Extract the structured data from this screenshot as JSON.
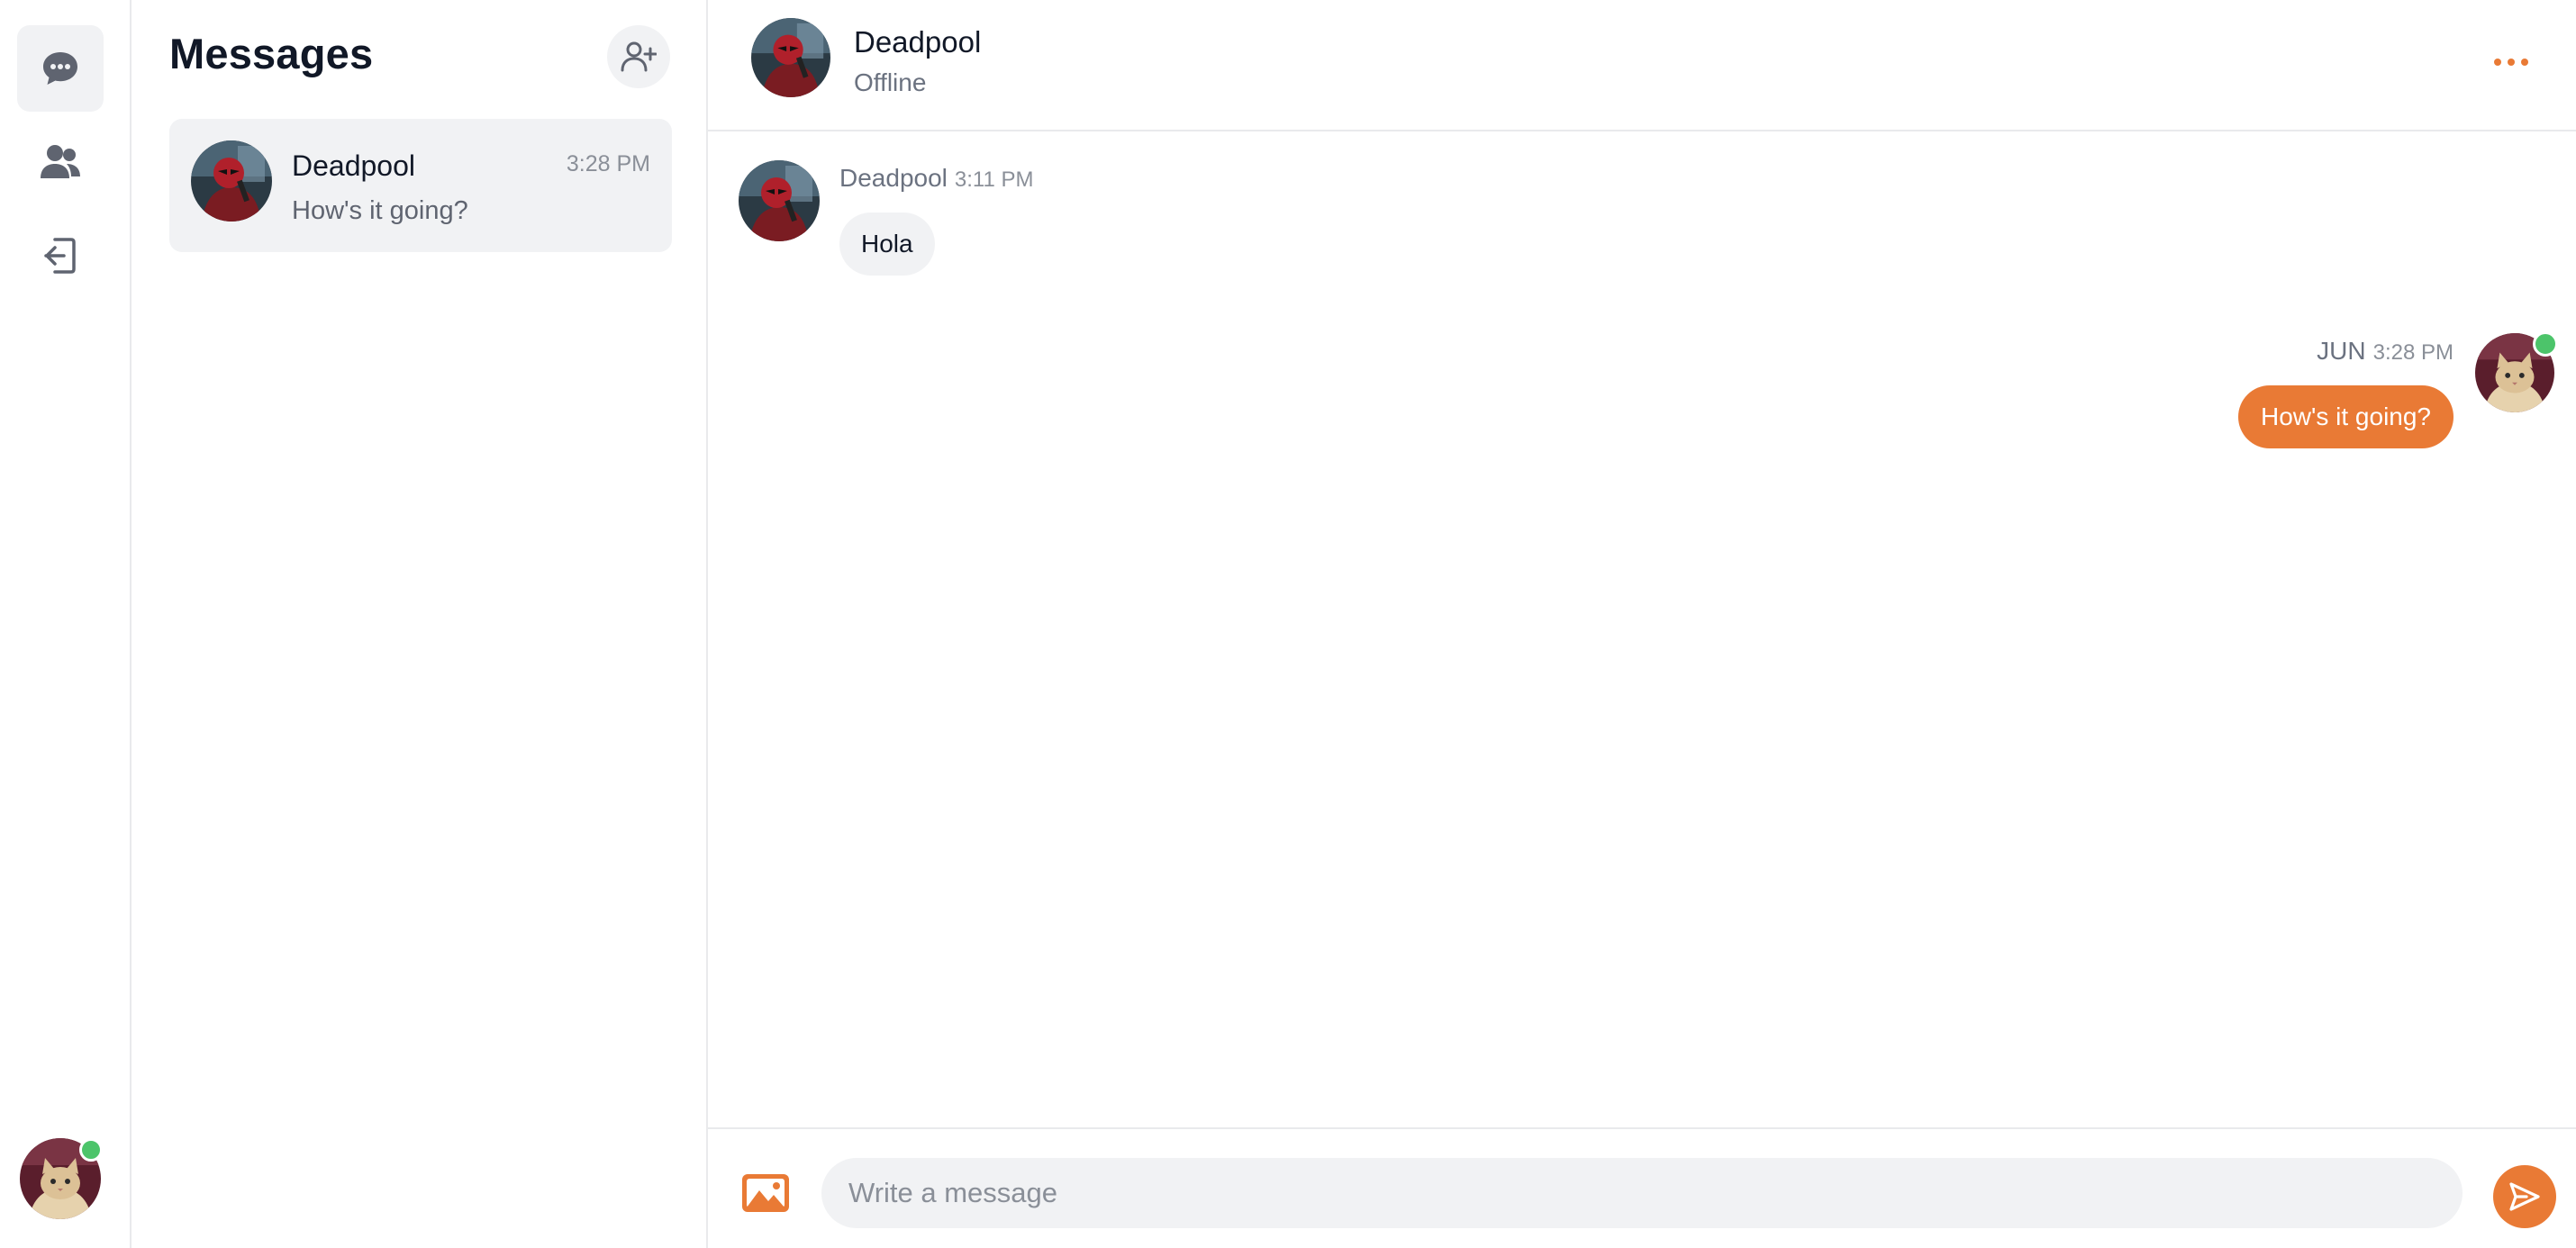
{
  "rail": {
    "items": [
      {
        "name": "messages",
        "icon": "chat-bubble-icon",
        "active": true
      },
      {
        "name": "contacts",
        "icon": "users-icon",
        "active": false
      },
      {
        "name": "logout",
        "icon": "logout-icon",
        "active": false
      }
    ],
    "user_online": true
  },
  "list": {
    "title": "Messages",
    "new_chat_icon": "add-user-icon",
    "conversations": [
      {
        "name": "Deadpool",
        "time": "3:28 PM",
        "preview": "How's it going?",
        "selected": true
      }
    ]
  },
  "chat": {
    "header": {
      "name": "Deadpool",
      "status": "Offline",
      "menu_icon": "more-horizontal-icon"
    },
    "messages": [
      {
        "direction": "incoming",
        "sender": "Deadpool",
        "time": "3:11 PM",
        "text": "Hola"
      },
      {
        "direction": "outgoing",
        "sender": "JUN",
        "time": "3:28 PM",
        "text": "How's it going?"
      }
    ],
    "composer": {
      "placeholder": "Write a message",
      "value": "",
      "attach_icon": "image-icon",
      "send_icon": "send-icon"
    }
  },
  "colors": {
    "accent": "#e97a35",
    "online": "#4cc46a",
    "surface": "#f1f2f4",
    "icon": "#5f6470"
  }
}
